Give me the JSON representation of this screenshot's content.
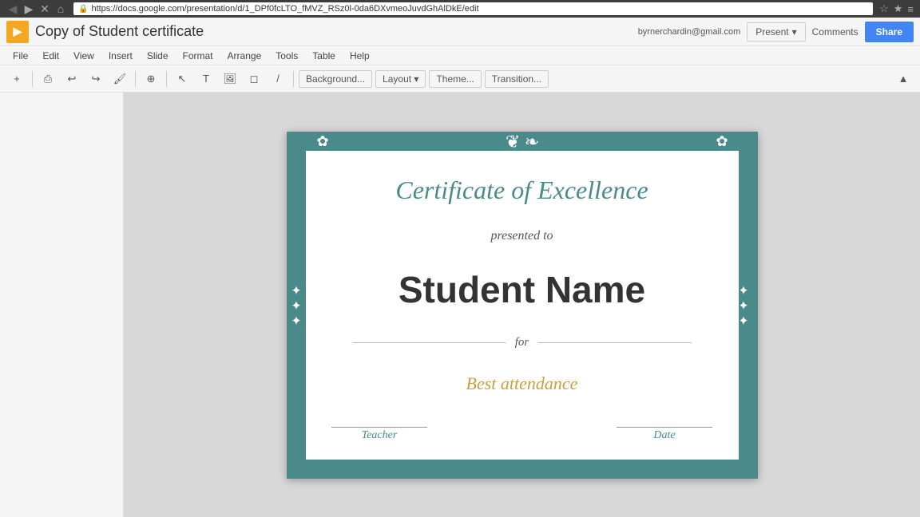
{
  "browser": {
    "url": "https://docs.google.com/presentation/d/1_DPf0fcLTO_fMVZ_RSz0l-0da6DXvmeoJuvdGhAlDkE/edit",
    "back_icon": "◀",
    "forward_icon": "▶",
    "close_icon": "✕",
    "home_icon": "⌂",
    "lock_icon": "🔒",
    "star_icon": "☆",
    "menu_icon": "≡",
    "user_email": "byrnerchardin@gmail.com"
  },
  "titlebar": {
    "app_icon": "▶",
    "doc_title": "Copy of Student certificate",
    "present_label": "Present",
    "comments_label": "Comments",
    "share_label": "Share"
  },
  "menubar": {
    "items": [
      "File",
      "Edit",
      "View",
      "Insert",
      "Slide",
      "Format",
      "Arrange",
      "Tools",
      "Table",
      "Help"
    ]
  },
  "toolbar": {
    "background_label": "Background...",
    "layout_label": "Layout ▾",
    "theme_label": "Theme...",
    "transition_label": "Transition..."
  },
  "certificate": {
    "title": "Certificate of Excellence",
    "presented_to": "presented to",
    "student_name": "Student Name",
    "for_text": "for",
    "achievement": "Best attendance",
    "teacher_label": "Teacher",
    "date_label": "Date"
  }
}
